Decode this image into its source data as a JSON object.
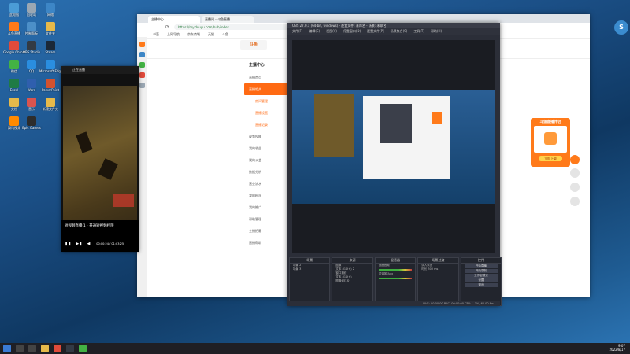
{
  "desktop": {
    "icons": [
      {
        "label": "此电脑",
        "color": "#4b9cd6"
      },
      {
        "label": "回收站",
        "color": "#9aa7b3"
      },
      {
        "label": "网络",
        "color": "#3d86c6"
      },
      {
        "label": "斗鱼直播",
        "color": "#ff7a1a"
      },
      {
        "label": "控制面板",
        "color": "#4c8fc8"
      },
      {
        "label": "文件夹",
        "color": "#e6b94a"
      },
      {
        "label": "Google Chrome",
        "color": "#e04b3b"
      },
      {
        "label": "OBS Studio",
        "color": "#333a44"
      },
      {
        "label": "Steam",
        "color": "#1b2838"
      },
      {
        "label": "微信",
        "color": "#43b244"
      },
      {
        "label": "QQ",
        "color": "#2a8ee0"
      },
      {
        "label": "Microsoft Edge",
        "color": "#2a8ee0"
      },
      {
        "label": "Excel",
        "color": "#1f7b45"
      },
      {
        "label": "Word",
        "color": "#2f5fae"
      },
      {
        "label": "PowerPoint",
        "color": "#d2522f"
      },
      {
        "label": "文档",
        "color": "#e6b94a"
      },
      {
        "label": "音乐",
        "color": "#d9544f"
      },
      {
        "label": "新建文件夹",
        "color": "#e6b94a"
      },
      {
        "label": "腾讯视频",
        "color": "#ff8a00"
      },
      {
        "label": "Epic Games",
        "color": "#2d2d2d"
      }
    ]
  },
  "browser": {
    "tabs": [
      {
        "label": "主播中心"
      },
      {
        "label": "直播间 - 斗鱼直播"
      }
    ],
    "url": "https://my.douyu.com/hub/index",
    "bookmarks": [
      "书签",
      "上网导航",
      "京东商城",
      "天猫",
      "斗鱼"
    ],
    "site_logo": "斗鱼",
    "menu": {
      "header": "主播中心",
      "items": [
        "直播首页",
        "直播相关",
        "房间管理",
        "直播设置",
        "直播记录",
        "视频投稿",
        "我的收益",
        "我的公会",
        "数据分析",
        "营业流水",
        "我的粉丝",
        "我的推广",
        "帮助管理",
        "主播招募",
        "直播帮助"
      ]
    },
    "promo": {
      "title": "斗鱼直播伴侣",
      "button": "立即下载"
    }
  },
  "obs": {
    "title": "OBS 27.0.1 (64-bit, windows) - 配置文件: 未命名 - 场景: 未命名",
    "menu": [
      "文件(F)",
      "编辑(E)",
      "视图(V)",
      "停靠窗口(D)",
      "配置文件(P)",
      "场景集合(S)",
      "工具(T)",
      "帮助(H)"
    ],
    "docks": {
      "scenes": {
        "title": "场景",
        "items": [
          "场景 2",
          "场景 3"
        ]
      },
      "sources": {
        "title": "来源",
        "items": [
          "图像",
          "文本 (GDI+) 2",
          "窗口捕获",
          "文本 (GDI+)",
          "图像幻灯片"
        ]
      },
      "mixer": {
        "title": "混音器",
        "items": [
          "桌面音频",
          "麦克风/Aux"
        ]
      },
      "transitions": {
        "title": "场景过渡",
        "type": "淡入淡出",
        "duration_label": "时长",
        "duration": "300 ms"
      },
      "controls": {
        "title": "控件",
        "buttons": [
          "开始直播",
          "开始录制",
          "工作室模式",
          "设置",
          "退出"
        ]
      }
    },
    "status": "LIVE: 00:00:00   REC: 00:00:00   CPU: 1.3%, 60.00 fps"
  },
  "game_window": {
    "title": "正在直播",
    "caption": "短视频直播 1 · 开通短视频权限",
    "time": "00:00:24 / 01:03:25"
  },
  "taskbar": {
    "time": "9:07",
    "date": "2022/8/17"
  }
}
